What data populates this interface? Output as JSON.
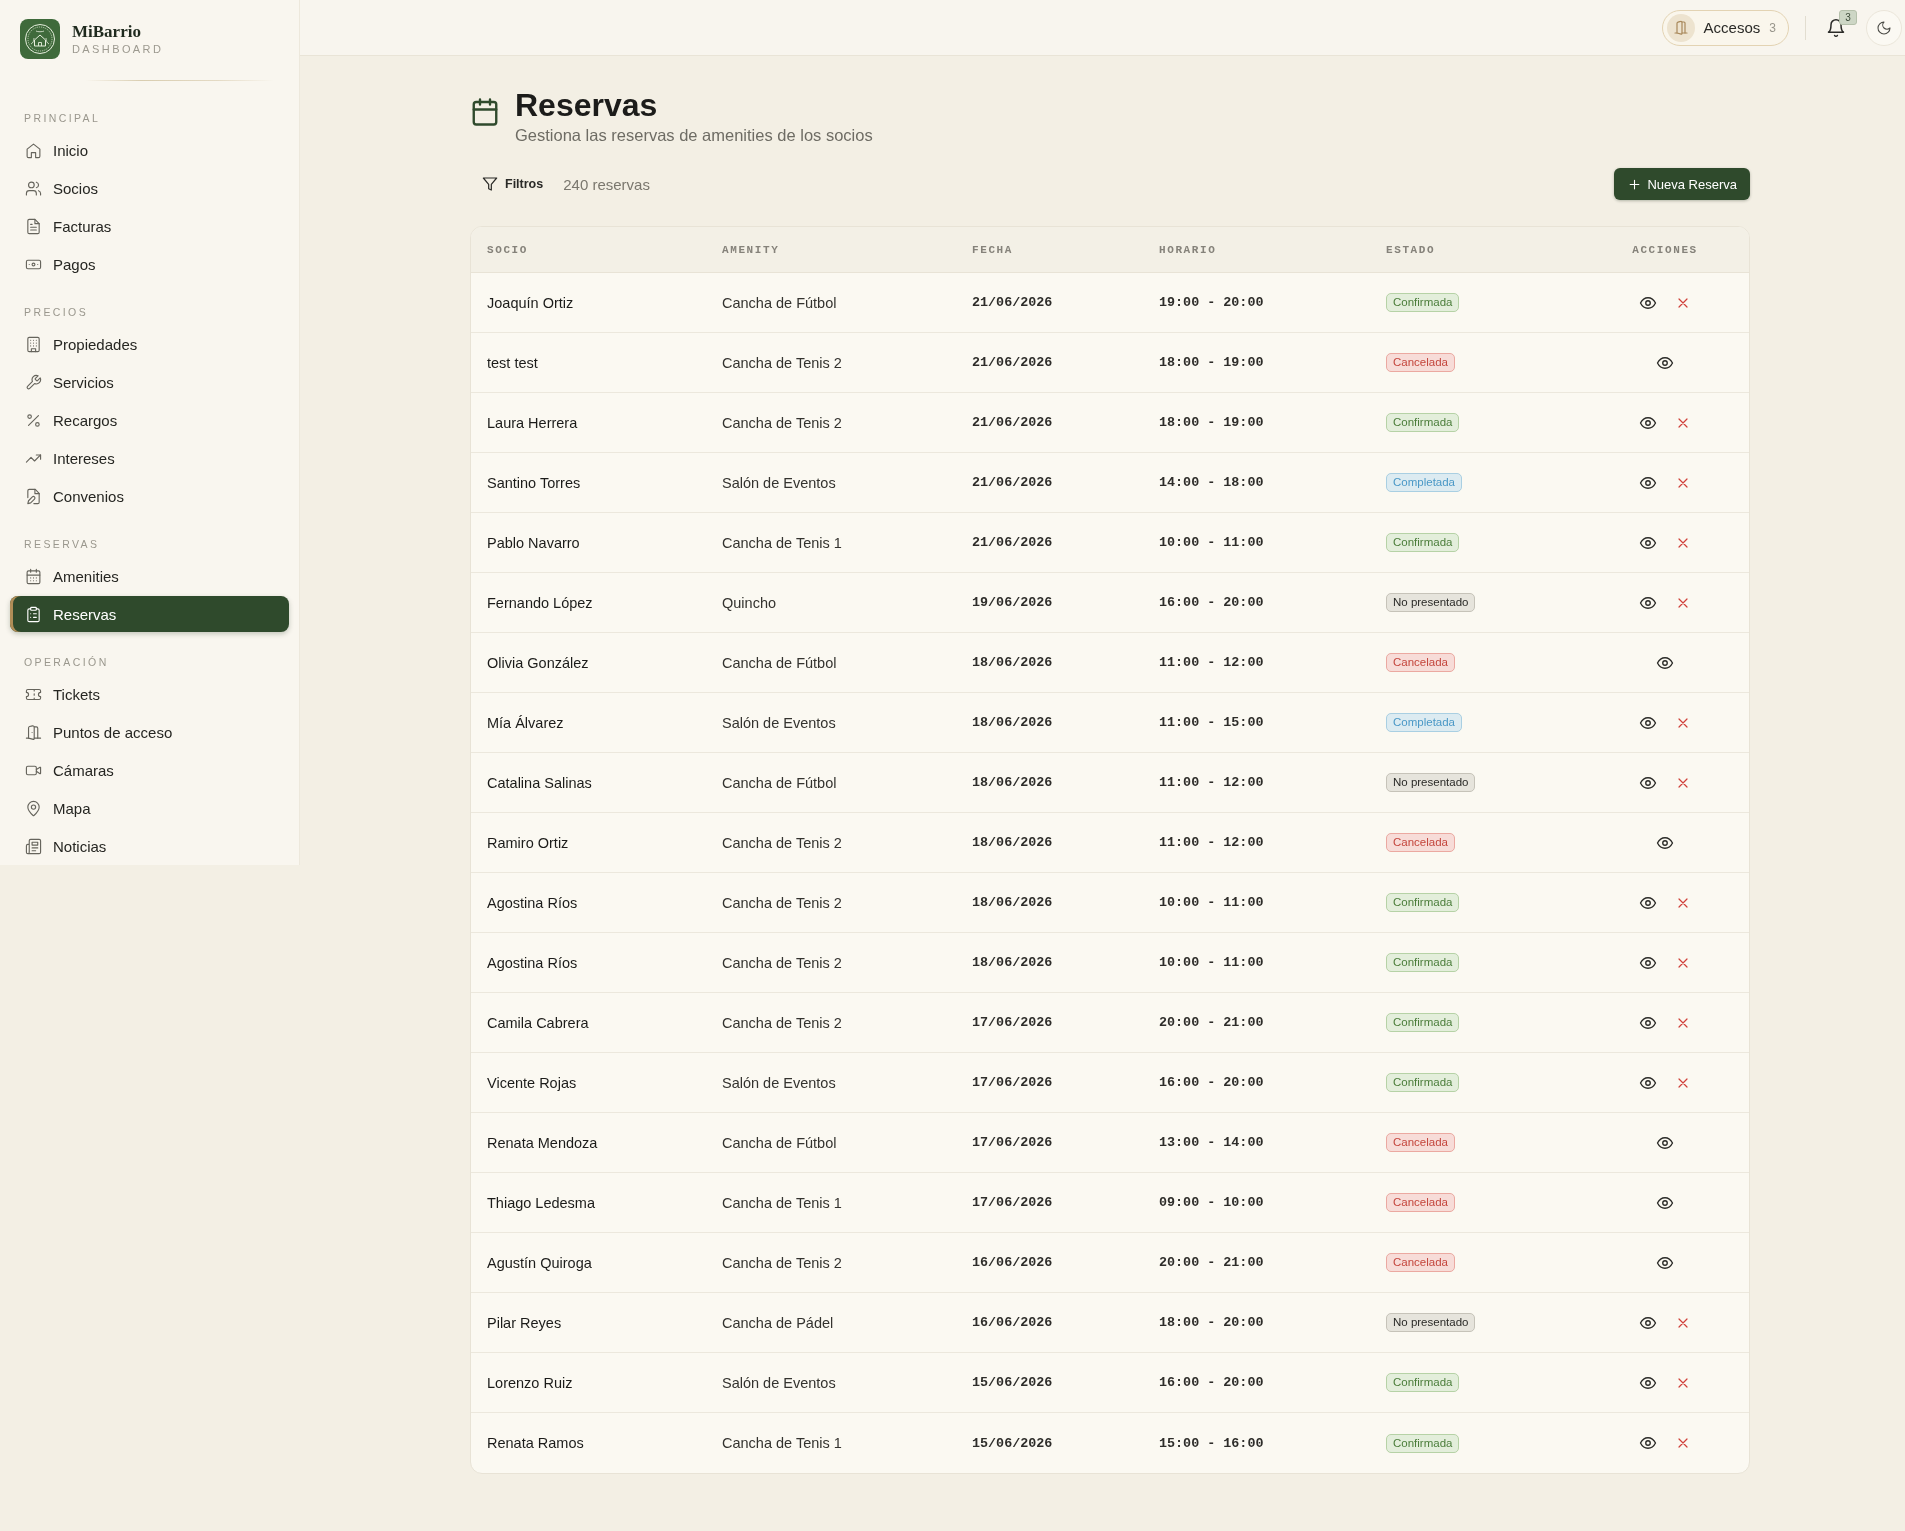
{
  "sidebar": {
    "brand": {
      "name": "MiBarrio",
      "subtitle": "DASHBOARD"
    },
    "sections": [
      {
        "label": "PRINCIPAL",
        "items": [
          {
            "label": "Inicio",
            "selected": false
          },
          {
            "label": "Socios",
            "selected": false
          },
          {
            "label": "Facturas",
            "selected": false
          },
          {
            "label": "Pagos",
            "selected": false
          }
        ]
      },
      {
        "label": "PRECIOS",
        "items": [
          {
            "label": "Propiedades",
            "selected": false
          },
          {
            "label": "Servicios",
            "selected": false
          },
          {
            "label": "Recargos",
            "selected": false
          },
          {
            "label": "Intereses",
            "selected": false
          },
          {
            "label": "Convenios",
            "selected": false
          }
        ]
      },
      {
        "label": "RESERVAS",
        "items": [
          {
            "label": "Amenities",
            "selected": false
          },
          {
            "label": "Reservas",
            "selected": true
          }
        ]
      },
      {
        "label": "OPERACIÓN",
        "items": [
          {
            "label": "Tickets",
            "selected": false
          },
          {
            "label": "Puntos de acceso",
            "selected": false
          },
          {
            "label": "Cámaras",
            "selected": false
          },
          {
            "label": "Mapa",
            "selected": false
          },
          {
            "label": "Noticias",
            "selected": false
          }
        ]
      }
    ]
  },
  "topbar": {
    "access_button": {
      "label": "Accesos",
      "count": "3"
    },
    "notifications": {
      "count": "3"
    }
  },
  "page": {
    "title": "Reservas",
    "subtitle": "Gestiona las reservas de amenities de los socios"
  },
  "toolbar": {
    "filter_button": "Filtros",
    "count": "240 reservas",
    "new_button": "Nueva Reserva"
  },
  "table": {
    "columns": [
      "SOCIO",
      "AMENITY",
      "FECHA",
      "HORARIO",
      "ESTADO",
      "ACCIONES"
    ],
    "rows": [
      {
        "socio": "Joaquín Ortiz",
        "amenity": "Cancha de Fútbol",
        "fecha": "21/06/2026",
        "horario": "19:00 - 20:00",
        "status": {
          "label": "Confirmada",
          "kind": "confirmed"
        },
        "cancelable": true
      },
      {
        "socio": "test test",
        "amenity": "Cancha de Tenis 2",
        "fecha": "21/06/2026",
        "horario": "18:00 - 19:00",
        "status": {
          "label": "Cancelada",
          "kind": "cancelled"
        },
        "cancelable": false
      },
      {
        "socio": "Laura Herrera",
        "amenity": "Cancha de Tenis 2",
        "fecha": "21/06/2026",
        "horario": "18:00 - 19:00",
        "status": {
          "label": "Confirmada",
          "kind": "confirmed"
        },
        "cancelable": true
      },
      {
        "socio": "Santino Torres",
        "amenity": "Salón de Eventos",
        "fecha": "21/06/2026",
        "horario": "14:00 - 18:00",
        "status": {
          "label": "Completada",
          "kind": "completed"
        },
        "cancelable": true
      },
      {
        "socio": "Pablo Navarro",
        "amenity": "Cancha de Tenis 1",
        "fecha": "21/06/2026",
        "horario": "10:00 - 11:00",
        "status": {
          "label": "Confirmada",
          "kind": "confirmed"
        },
        "cancelable": true
      },
      {
        "socio": "Fernando López",
        "amenity": "Quincho",
        "fecha": "19/06/2026",
        "horario": "16:00 - 20:00",
        "status": {
          "label": "No presentado",
          "kind": "no_show"
        },
        "cancelable": true
      },
      {
        "socio": "Olivia González",
        "amenity": "Cancha de Fútbol",
        "fecha": "18/06/2026",
        "horario": "11:00 - 12:00",
        "status": {
          "label": "Cancelada",
          "kind": "cancelled"
        },
        "cancelable": false
      },
      {
        "socio": "Mía Álvarez",
        "amenity": "Salón de Eventos",
        "fecha": "18/06/2026",
        "horario": "11:00 - 15:00",
        "status": {
          "label": "Completada",
          "kind": "completed"
        },
        "cancelable": true
      },
      {
        "socio": "Catalina Salinas",
        "amenity": "Cancha de Fútbol",
        "fecha": "18/06/2026",
        "horario": "11:00 - 12:00",
        "status": {
          "label": "No presentado",
          "kind": "no_show"
        },
        "cancelable": true
      },
      {
        "socio": "Ramiro Ortiz",
        "amenity": "Cancha de Tenis 2",
        "fecha": "18/06/2026",
        "horario": "11:00 - 12:00",
        "status": {
          "label": "Cancelada",
          "kind": "cancelled"
        },
        "cancelable": false
      },
      {
        "socio": "Agostina Ríos",
        "amenity": "Cancha de Tenis 2",
        "fecha": "18/06/2026",
        "horario": "10:00 - 11:00",
        "status": {
          "label": "Confirmada",
          "kind": "confirmed"
        },
        "cancelable": true
      },
      {
        "socio": "Agostina Ríos",
        "amenity": "Cancha de Tenis 2",
        "fecha": "18/06/2026",
        "horario": "10:00 - 11:00",
        "status": {
          "label": "Confirmada",
          "kind": "confirmed"
        },
        "cancelable": true
      },
      {
        "socio": "Camila Cabrera",
        "amenity": "Cancha de Tenis 2",
        "fecha": "17/06/2026",
        "horario": "20:00 - 21:00",
        "status": {
          "label": "Confirmada",
          "kind": "confirmed"
        },
        "cancelable": true
      },
      {
        "socio": "Vicente Rojas",
        "amenity": "Salón de Eventos",
        "fecha": "17/06/2026",
        "horario": "16:00 - 20:00",
        "status": {
          "label": "Confirmada",
          "kind": "confirmed"
        },
        "cancelable": true
      },
      {
        "socio": "Renata Mendoza",
        "amenity": "Cancha de Fútbol",
        "fecha": "17/06/2026",
        "horario": "13:00 - 14:00",
        "status": {
          "label": "Cancelada",
          "kind": "cancelled"
        },
        "cancelable": false
      },
      {
        "socio": "Thiago Ledesma",
        "amenity": "Cancha de Tenis 1",
        "fecha": "17/06/2026",
        "horario": "09:00 - 10:00",
        "status": {
          "label": "Cancelada",
          "kind": "cancelled"
        },
        "cancelable": false
      },
      {
        "socio": "Agustín Quiroga",
        "amenity": "Cancha de Tenis 2",
        "fecha": "16/06/2026",
        "horario": "20:00 - 21:00",
        "status": {
          "label": "Cancelada",
          "kind": "cancelled"
        },
        "cancelable": false
      },
      {
        "socio": "Pilar Reyes",
        "amenity": "Cancha de Pádel",
        "fecha": "16/06/2026",
        "horario": "18:00 - 20:00",
        "status": {
          "label": "No presentado",
          "kind": "no_show"
        },
        "cancelable": true
      },
      {
        "socio": "Lorenzo Ruiz",
        "amenity": "Salón de Eventos",
        "fecha": "15/06/2026",
        "horario": "16:00 - 20:00",
        "status": {
          "label": "Confirmada",
          "kind": "confirmed"
        },
        "cancelable": true
      },
      {
        "socio": "Renata Ramos",
        "amenity": "Cancha de Tenis 1",
        "fecha": "15/06/2026",
        "horario": "15:00 - 16:00",
        "status": {
          "label": "Confirmada",
          "kind": "confirmed"
        },
        "cancelable": true
      }
    ]
  }
}
